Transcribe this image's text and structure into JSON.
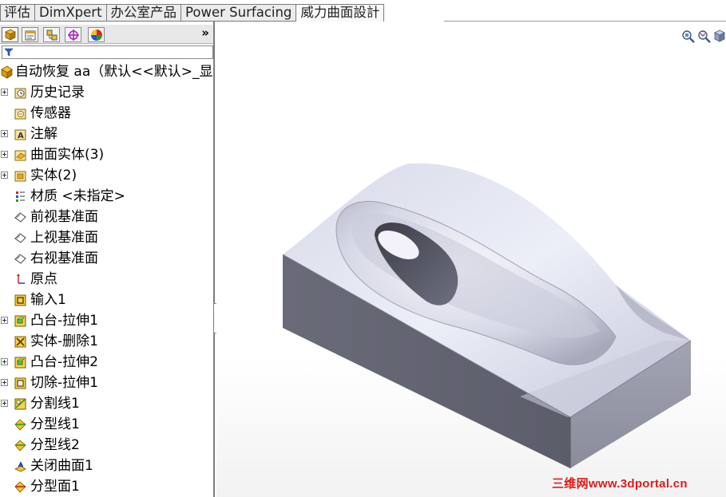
{
  "tabs": [
    {
      "label": "评估",
      "active": false
    },
    {
      "label": "DimXpert",
      "active": false
    },
    {
      "label": "办公室产品",
      "active": false
    },
    {
      "label": "Power Surfacing",
      "active": false
    },
    {
      "label": "威力曲面設計",
      "active": true
    }
  ],
  "manager_tabs": [
    {
      "icon": "feature-manager-icon",
      "active": true
    },
    {
      "icon": "property-manager-icon",
      "active": false
    },
    {
      "icon": "configuration-manager-icon",
      "active": false
    },
    {
      "icon": "dimxpert-manager-icon",
      "active": false
    },
    {
      "icon": "display-manager-icon",
      "active": false
    }
  ],
  "expand_label": "»",
  "tree": {
    "root": "自动恢复 aa（默认<<默认>_显",
    "items": [
      {
        "label": "历史记录",
        "icon": "history-icon",
        "expandable": true
      },
      {
        "label": "传感器",
        "icon": "sensor-icon",
        "expandable": false
      },
      {
        "label": "注解",
        "icon": "annotation-icon",
        "expandable": true
      },
      {
        "label": "曲面实体(3)",
        "icon": "surface-bodies-icon",
        "expandable": true
      },
      {
        "label": "实体(2)",
        "icon": "solid-bodies-icon",
        "expandable": true
      },
      {
        "label": "材质 <未指定>",
        "icon": "material-icon",
        "expandable": false
      },
      {
        "label": "前视基准面",
        "icon": "plane-icon",
        "expandable": false
      },
      {
        "label": "上视基准面",
        "icon": "plane-icon",
        "expandable": false
      },
      {
        "label": "右视基准面",
        "icon": "plane-icon",
        "expandable": false
      },
      {
        "label": "原点",
        "icon": "origin-icon",
        "expandable": false
      },
      {
        "label": "输入1",
        "icon": "import-icon",
        "expandable": false
      },
      {
        "label": "凸台-拉伸1",
        "icon": "boss-extrude-icon",
        "expandable": true
      },
      {
        "label": "实体-删除1",
        "icon": "body-delete-icon",
        "expandable": false
      },
      {
        "label": "凸台-拉伸2",
        "icon": "boss-extrude-icon",
        "expandable": true
      },
      {
        "label": "切除-拉伸1",
        "icon": "cut-extrude-icon",
        "expandable": true
      },
      {
        "label": "分割线1",
        "icon": "split-line-icon",
        "expandable": true
      },
      {
        "label": "分型线1",
        "icon": "parting-line-icon",
        "expandable": false
      },
      {
        "label": "分型线2",
        "icon": "parting-line-icon",
        "expandable": false
      },
      {
        "label": "关闭曲面1",
        "icon": "shut-off-surface-icon",
        "expandable": false
      },
      {
        "label": "分型面1",
        "icon": "parting-surface-icon",
        "expandable": false
      }
    ]
  },
  "watermark": "三维网www.3dportal.cn",
  "colors": {
    "model_top": "#d4d6e6",
    "model_side": "#62636f",
    "model_front": "#9395a5",
    "watermark": "#e01a1a"
  }
}
